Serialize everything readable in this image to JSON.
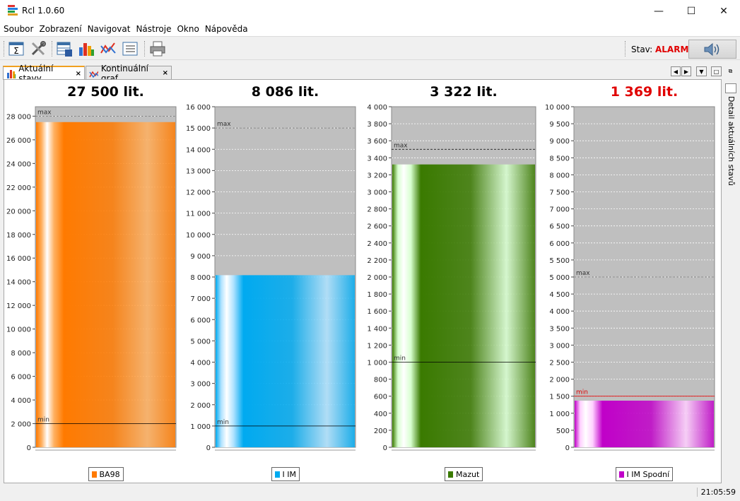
{
  "window": {
    "title": "Rcl 1.0.60",
    "minimize_glyph": "—",
    "maximize_glyph": "☐",
    "close_glyph": "✕"
  },
  "menu": [
    "Soubor",
    "Zobrazení",
    "Navigovat",
    "Nástroje",
    "Okno",
    "Nápověda"
  ],
  "toolbar": {
    "buttons": [
      "sigma-icon",
      "tools-icon",
      "table-save-icon",
      "bar-chart-icon",
      "line-chart-icon",
      "list-icon",
      "printer-icon"
    ],
    "status_label": "Stav:",
    "status_value": "ALARM",
    "sound_icon": "speaker-icon"
  },
  "tabs": [
    {
      "label": "Aktuální stavy",
      "icon": "bar-chart-icon",
      "close": "×",
      "active": true
    },
    {
      "label": "Kontinuální graf",
      "icon": "line-chart-icon",
      "close": "×",
      "active": false
    }
  ],
  "side_panel": {
    "label": "Detail aktuálních stavů"
  },
  "statusbar": {
    "time": "21:05:59"
  },
  "colors": {
    "alarm": "#e00000",
    "plot_bg": "#bfbfbf"
  },
  "chart_data": [
    {
      "type": "bar",
      "title": "27 500 lit.",
      "title_color": "#000000",
      "series": [
        {
          "name": "BA98",
          "values": [
            27500
          ]
        }
      ],
      "ylim": [
        0,
        28800
      ],
      "ticks": [
        0,
        2000,
        4000,
        6000,
        8000,
        10000,
        12000,
        14000,
        16000,
        18000,
        20000,
        22000,
        24000,
        26000,
        28000
      ],
      "tick_labels": [
        "0",
        "2 000",
        "4 000",
        "6 000",
        "8 000",
        "10 000",
        "12 000",
        "14 000",
        "16 000",
        "18 000",
        "20 000",
        "22 000",
        "24 000",
        "26 000",
        "28 000"
      ],
      "max_line": 28000,
      "max_label": "max",
      "min_line": 2000,
      "min_label": "min",
      "bar_color": "#ff7a00",
      "bar_light": "#ffb060",
      "min_color": "#000000",
      "max_color": "#777777"
    },
    {
      "type": "bar",
      "title": "8 086 lit.",
      "title_color": "#000000",
      "series": [
        {
          "name": "I IM",
          "values": [
            8086
          ]
        }
      ],
      "ylim": [
        0,
        16000
      ],
      "ticks": [
        0,
        1000,
        2000,
        3000,
        4000,
        5000,
        6000,
        7000,
        8000,
        9000,
        10000,
        11000,
        12000,
        13000,
        14000,
        15000,
        16000
      ],
      "tick_labels": [
        "0",
        "1 000",
        "2 000",
        "3 000",
        "4 000",
        "5 000",
        "6 000",
        "7 000",
        "8 000",
        "9 000",
        "10 000",
        "11 000",
        "12 000",
        "13 000",
        "14 000",
        "15 000",
        "16 000"
      ],
      "max_line": 15000,
      "max_label": "max",
      "min_line": 1000,
      "min_label": "min",
      "bar_color": "#00aaf0",
      "bar_light": "#aee2ff",
      "min_color": "#000000",
      "max_color": "#777777"
    },
    {
      "type": "bar",
      "title": "3 322 lit.",
      "title_color": "#000000",
      "series": [
        {
          "name": "Mazut",
          "values": [
            3322
          ]
        }
      ],
      "ylim": [
        0,
        4000
      ],
      "ticks": [
        0,
        200,
        400,
        600,
        800,
        1000,
        1200,
        1400,
        1600,
        1800,
        2000,
        2200,
        2400,
        2600,
        2800,
        3000,
        3200,
        3400,
        3600,
        3800,
        4000
      ],
      "tick_labels": [
        "0",
        "200",
        "400",
        "600",
        "800",
        "1 000",
        "1 200",
        "1 400",
        "1 600",
        "1 800",
        "2 000",
        "2 200",
        "2 400",
        "2 600",
        "2 800",
        "3 000",
        "3 200",
        "3 400",
        "3 600",
        "3 800",
        "4 000"
      ],
      "max_line": 3500,
      "max_label": "max",
      "min_line": 1000,
      "min_label": "min",
      "bar_color": "#3a7a00",
      "bar_light": "#d8ffd0",
      "min_color": "#000000",
      "max_color": "#000000"
    },
    {
      "type": "bar",
      "title": "1 369 lit.",
      "title_color": "#e00000",
      "series": [
        {
          "name": "I IM Spodní",
          "values": [
            1369
          ]
        }
      ],
      "ylim": [
        0,
        10000
      ],
      "ticks": [
        0,
        500,
        1000,
        1500,
        2000,
        2500,
        3000,
        3500,
        4000,
        4500,
        5000,
        5500,
        6000,
        6500,
        7000,
        7500,
        8000,
        8500,
        9000,
        9500,
        10000
      ],
      "tick_labels": [
        "0",
        "500",
        "1 000",
        "1 500",
        "2 000",
        "2 500",
        "3 000",
        "3 500",
        "4 000",
        "4 500",
        "5 000",
        "5 500",
        "6 000",
        "6 500",
        "7 000",
        "7 500",
        "8 000",
        "8 500",
        "9 000",
        "9 500",
        "10 000"
      ],
      "max_line": 5000,
      "max_label": "max",
      "min_line": 1500,
      "min_label": "min",
      "bar_color": "#c000c8",
      "bar_light": "#ffd0ff",
      "min_color": "#e00000",
      "max_color": "#777777"
    }
  ]
}
